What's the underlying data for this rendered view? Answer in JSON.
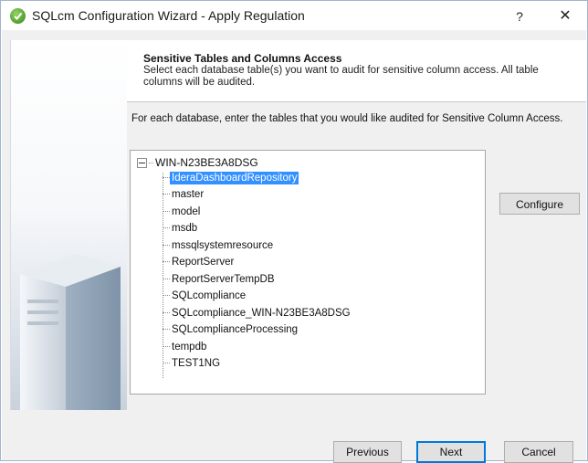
{
  "window": {
    "title": "SQLcm Configuration Wizard - Apply Regulation",
    "help_label": "?",
    "close_label": "✕",
    "app_icon": "check-circle-icon"
  },
  "header": {
    "title": "Sensitive Tables and Columns Access",
    "description": "Select each database table(s) you want to audit for sensitive column access. All table columns will be audited."
  },
  "instruction": "For each database, enter the tables that you would like audited for Sensitive Column Access.",
  "tree": {
    "root": "WIN-N23BE3A8DSG",
    "items": [
      {
        "label": "IderaDashboardRepository",
        "selected": true
      },
      {
        "label": "master"
      },
      {
        "label": "model"
      },
      {
        "label": "msdb"
      },
      {
        "label": "mssqlsystemresource"
      },
      {
        "label": "ReportServer"
      },
      {
        "label": "ReportServerTempDB"
      },
      {
        "label": "SQLcompliance"
      },
      {
        "label": "SQLcompliance_WIN-N23BE3A8DSG"
      },
      {
        "label": "SQLcomplianceProcessing"
      },
      {
        "label": "tempdb"
      },
      {
        "label": "TEST1NG"
      }
    ]
  },
  "buttons": {
    "configure": "Configure",
    "previous": "Previous",
    "next": "Next",
    "cancel": "Cancel"
  },
  "colors": {
    "selection": "#3390ff",
    "default_button_border": "#0078d7"
  }
}
